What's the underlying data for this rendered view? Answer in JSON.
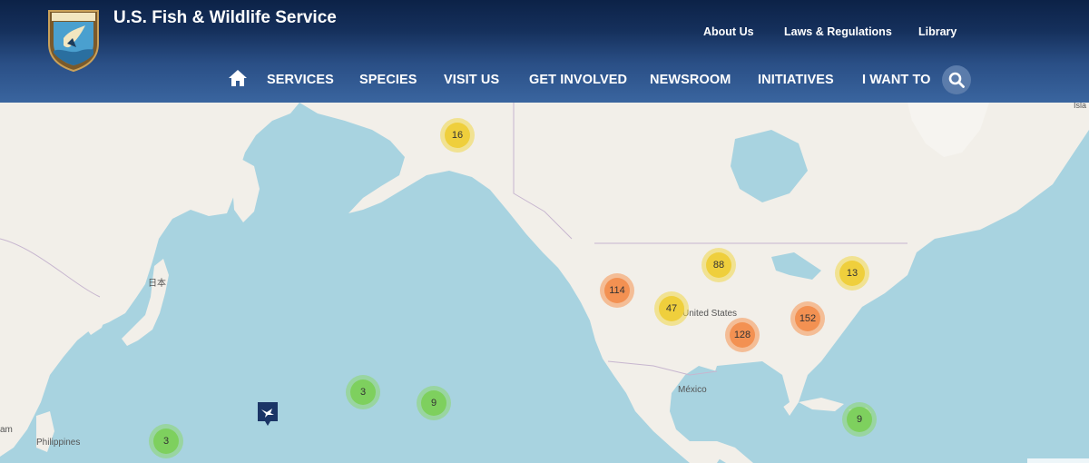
{
  "header": {
    "site_title": "U.S. Fish & Wildlife Service",
    "logo_text": "U.S. FISH & WILDLIFE SERVICE",
    "util_nav": [
      "About Us",
      "Laws & Regulations",
      "Library"
    ],
    "main_nav": [
      "SERVICES",
      "SPECIES",
      "VISIT US",
      "GET INVOLVED",
      "NEWSROOM",
      "INITIATIVES",
      "I WANT TO"
    ]
  },
  "map": {
    "labels": {
      "japan": "日本",
      "united_states": "United States",
      "mexico": "México",
      "philippines": "Philippines",
      "left_edge": "am",
      "right_edge": "Isla"
    },
    "clusters": [
      {
        "count": "16",
        "level": "yellow"
      },
      {
        "count": "88",
        "level": "yellow"
      },
      {
        "count": "13",
        "level": "yellow"
      },
      {
        "count": "114",
        "level": "orange"
      },
      {
        "count": "47",
        "level": "yellow"
      },
      {
        "count": "152",
        "level": "orange"
      },
      {
        "count": "128",
        "level": "orange"
      },
      {
        "count": "3",
        "level": "green"
      },
      {
        "count": "9",
        "level": "green"
      },
      {
        "count": "9",
        "level": "green"
      },
      {
        "count": "3",
        "level": "green"
      }
    ],
    "marker_icon": "fws-location-marker-icon"
  },
  "colors": {
    "header_dark": "#0c2247",
    "header_light": "#3a659f",
    "water": "#a8d3e0",
    "land": "#f2efe9",
    "green": "#7ed05e",
    "yellow": "#efcf3c",
    "orange": "#f39152"
  }
}
